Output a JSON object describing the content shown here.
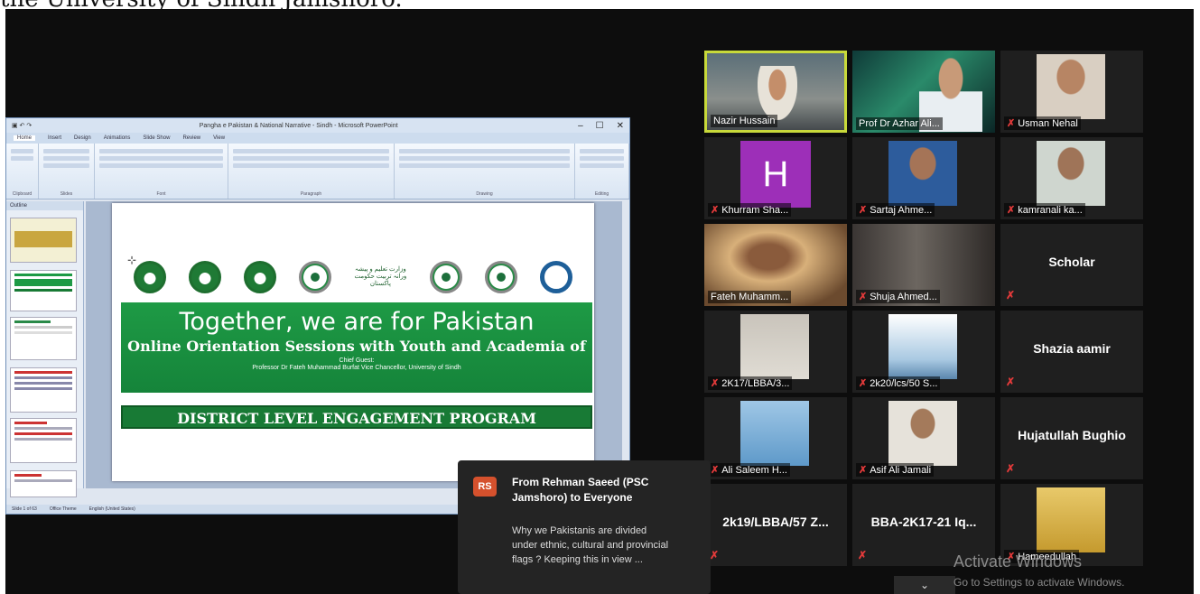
{
  "caption": "the University of Sindh Jamshoro.",
  "powerpoint": {
    "window_title": "Pangha e Pakistan & National Narrative - Sindh - Microsoft PowerPoint",
    "tabs": [
      "Home",
      "Insert",
      "Design",
      "Animations",
      "Slide Show",
      "Review",
      "View"
    ],
    "ribbon_groups": [
      "Clipboard",
      "Slides",
      "Font",
      "Paragraph",
      "Drawing",
      "Editing"
    ],
    "outline_label": "Outline",
    "status_text": "Slide 1 of 63",
    "status_theme": "Office Theme",
    "status_lang": "English (United States)",
    "slide": {
      "logo_caption": "وزارت تعلیم و پیشہ ورانہ تربیت حکومت پاکستان",
      "headline": "Together, we are for Pakistan",
      "subheadline": "Online Orientation Sessions with Youth and Academia of",
      "chief_guest_label": "Chief Guest:",
      "chief_guest": "Professor Dr Fateh Muhammad  Burfat Vice Chancellor, University of Sindh",
      "program": "DISTRICT LEVEL ENGAGEMENT PROGRAM"
    }
  },
  "participants": [
    {
      "name": "Nazir Hussain",
      "muted": false,
      "active": true,
      "kind": "video"
    },
    {
      "name": "Prof Dr Azhar Ali...",
      "muted": false,
      "active": false,
      "kind": "video"
    },
    {
      "name": "Usman Nehal",
      "muted": true,
      "active": false,
      "kind": "video"
    },
    {
      "name": "Khurram Sha...",
      "muted": true,
      "active": false,
      "kind": "avatar",
      "initial": "H"
    },
    {
      "name": "Sartaj Ahme...",
      "muted": true,
      "active": false,
      "kind": "photo"
    },
    {
      "name": "kamranali ka...",
      "muted": true,
      "active": false,
      "kind": "photo"
    },
    {
      "name": "Fateh Muhamm...",
      "muted": false,
      "active": false,
      "kind": "video"
    },
    {
      "name": "Shuja Ahmed...",
      "muted": true,
      "active": false,
      "kind": "video"
    },
    {
      "name": "Scholar",
      "muted": true,
      "active": false,
      "kind": "text"
    },
    {
      "name": "2K17/LBBA/3...",
      "muted": true,
      "active": false,
      "kind": "photo"
    },
    {
      "name": "2k20/lcs/50 S...",
      "muted": true,
      "active": false,
      "kind": "photo"
    },
    {
      "name": "Shazia aamir",
      "muted": true,
      "active": false,
      "kind": "text"
    },
    {
      "name": "Ali Saleem H...",
      "muted": true,
      "active": false,
      "kind": "photo"
    },
    {
      "name": "Asif Ali Jamali",
      "muted": true,
      "active": false,
      "kind": "photo"
    },
    {
      "name": "Hujatullah Bughio",
      "muted": true,
      "active": false,
      "kind": "text"
    },
    {
      "name": "2k19/LBBA/57 Z...",
      "muted": true,
      "active": false,
      "kind": "text"
    },
    {
      "name": "BBA-2K17-21 Iq...",
      "muted": true,
      "active": false,
      "kind": "text"
    },
    {
      "name": "Hameedullah",
      "muted": true,
      "active": false,
      "kind": "photo"
    }
  ],
  "chat": {
    "initials": "RS",
    "from": "From Rehman Saeed (PSC Jamshoro) to Everyone",
    "message": "Why we Pakistanis are divided under ethnic, cultural and provincial flags ? Keeping this in view ..."
  },
  "watermark": {
    "line1": "Activate Windows",
    "line2": "Go to Settings to activate Windows."
  },
  "colors": {
    "zoom_background": "#0d0d0d",
    "active_speaker_border": "#c8d93a",
    "slide_green": "#1e9a45",
    "chat_badge": "#d5512d",
    "mute_icon": "#e23a3a"
  }
}
